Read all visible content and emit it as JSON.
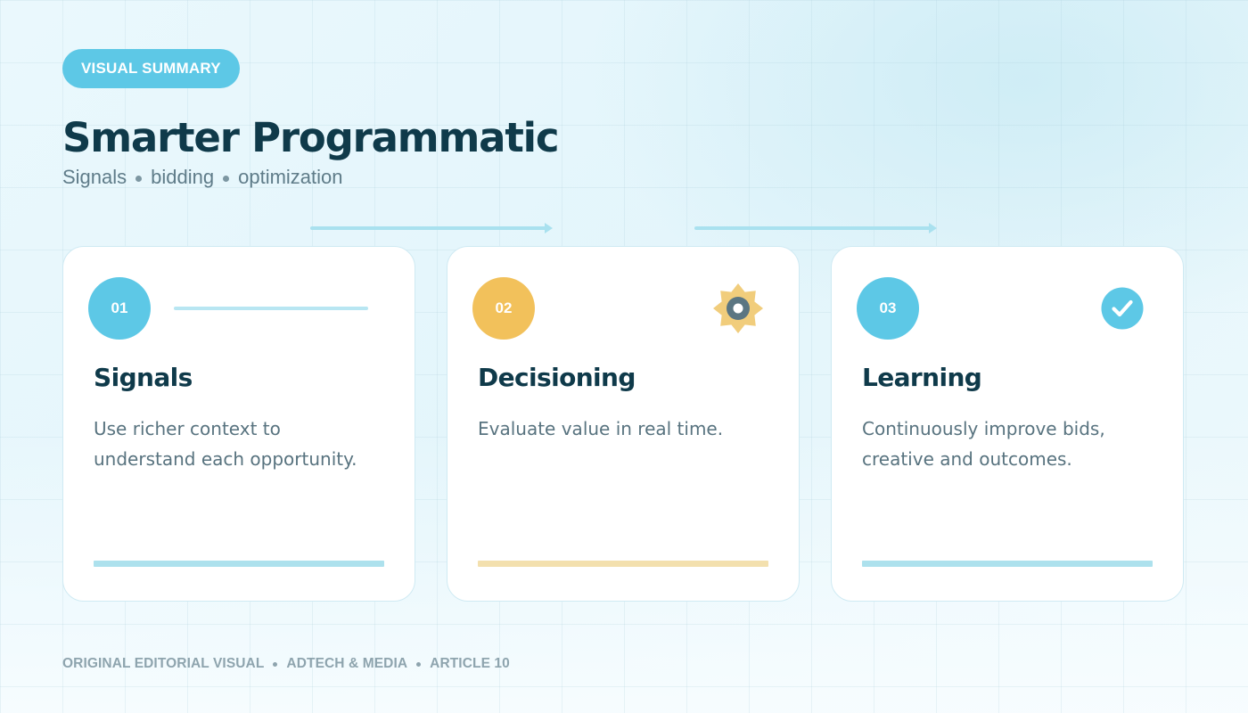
{
  "badge": "VISUAL SUMMARY",
  "title": "Smarter Programmatic",
  "subtitle": [
    "Signals",
    "bidding",
    "optimization"
  ],
  "cards": [
    {
      "number": "01",
      "title": "Signals",
      "text": "Use richer context to understand each opportunity.",
      "accent": "#5dc8e6",
      "bar_color": "#ade1ed",
      "icon": "divider-line"
    },
    {
      "number": "02",
      "title": "Decisioning",
      "text": "Evaluate value in real time.",
      "accent": "#f2c15b",
      "bar_color": "#f3e0ae",
      "icon": "gear-icon"
    },
    {
      "number": "03",
      "title": "Learning",
      "text": "Continuously improve bids, creative and outcomes.",
      "accent": "#5dc8e6",
      "bar_color": "#ade1ed",
      "icon": "check-circle-icon"
    }
  ],
  "footer": [
    "ORIGINAL EDITORIAL VISUAL",
    "ADTECH & MEDIA",
    "ARTICLE 10"
  ],
  "colors": {
    "title": "#0f3a4a",
    "text": "#58737f",
    "cyan": "#5dc8e6",
    "amber": "#f2c15b",
    "gear_center": "#5b7682"
  }
}
